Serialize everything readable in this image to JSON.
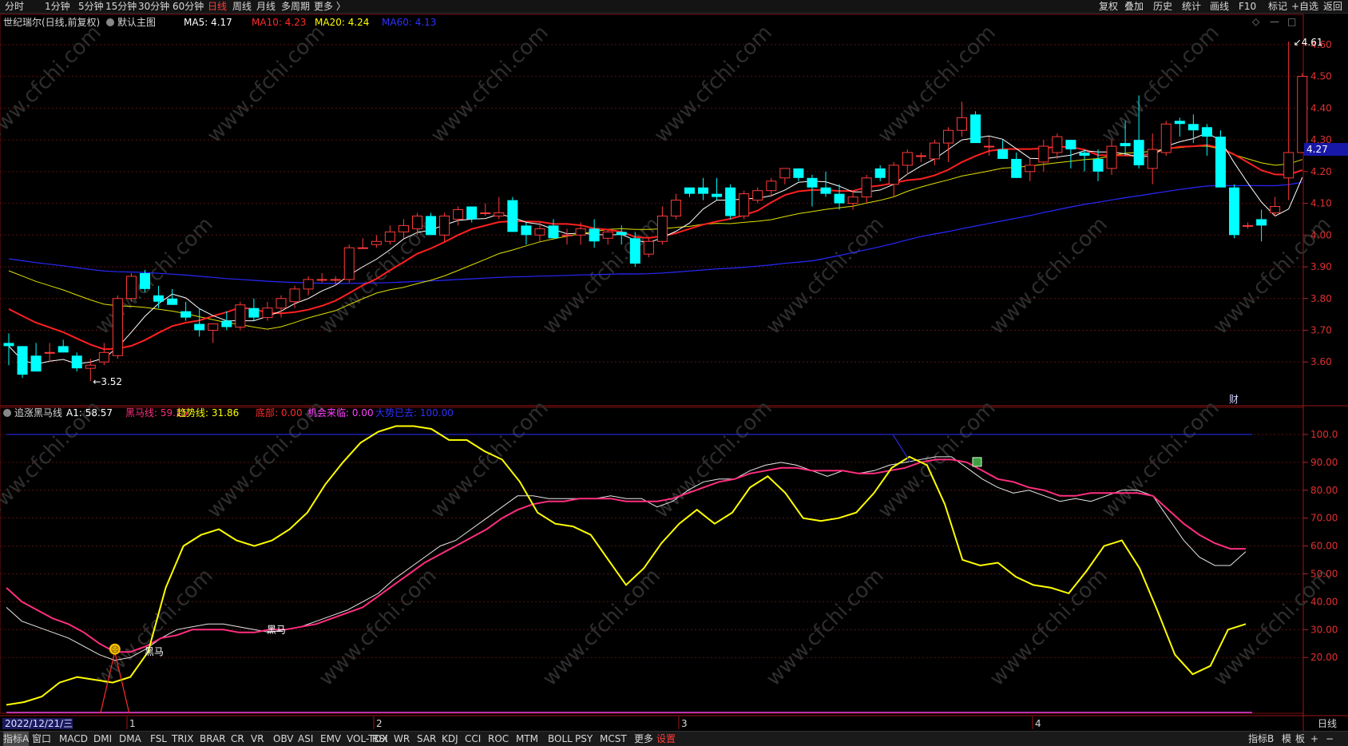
{
  "top_menu": {
    "left": [
      "分时",
      "1分钟",
      "5分钟",
      "15分钟",
      "30分钟",
      "60分钟",
      "日线",
      "周线",
      "月线",
      "多周期",
      "更多 〉"
    ],
    "active": "日线",
    "right": [
      "复权",
      "叠加",
      "历史",
      "统计",
      "画线",
      "F10",
      "标记",
      "+自选",
      "返回"
    ]
  },
  "price_panel": {
    "stock_name": "世纪瑞尔(日线,前复权)",
    "template": "默认主图",
    "ma_labels": [
      {
        "text": "MA5: 4.17",
        "color": "#ffffff"
      },
      {
        "text": "MA10: 4.23",
        "color": "#ff2b2b"
      },
      {
        "text": "MA20: 4.24",
        "color": "#ffff00"
      },
      {
        "text": "MA60: 4.13",
        "color": "#3030ff"
      }
    ],
    "y_ticks": [
      "4.60",
      "4.50",
      "4.40",
      "4.30",
      "4.20",
      "4.10",
      "4.00",
      "3.90",
      "3.80",
      "3.70",
      "3.60"
    ],
    "y_range": [
      3.52,
      4.63
    ],
    "current_price": "4.27",
    "high_mark": "4.61",
    "low_mark": "3.52",
    "fin_marker": "财",
    "window_icons": [
      "◇",
      "—",
      "□"
    ]
  },
  "indicator_panel": {
    "name": "追涨黑马线",
    "labels": [
      {
        "text": "A1: 58.57",
        "color": "#ffffff"
      },
      {
        "text": "黑马线: 59.15",
        "color": "#ff2e7e"
      },
      {
        "text": "趋势线: 31.86",
        "color": "#ffff00"
      },
      {
        "text": "底部: 0.00",
        "color": "#ff2b2b"
      },
      {
        "text": "机会来临: 0.00",
        "color": "#ff40ff"
      },
      {
        "text": "大势已去: 100.00",
        "color": "#3030ff"
      }
    ],
    "y_ticks": [
      "100.0",
      "90.00",
      "80.00",
      "70.00",
      "60.00",
      "50.00",
      "40.00",
      "30.00",
      "20.00"
    ],
    "y_range": [
      0,
      104
    ],
    "dark_horse_tag": "黑马"
  },
  "x_axis": {
    "date_label": "2022/12/21/三",
    "month_marks": [
      "1",
      "2",
      "3",
      "4"
    ],
    "period": "日线"
  },
  "bottom_tabs": {
    "items": [
      "指标A",
      "窗口",
      "MACD",
      "DMI",
      "DMA",
      "FSL",
      "TRIX",
      "BRAR",
      "CR",
      "VR",
      "OBV",
      "ASI",
      "EMV",
      "VOL-TDX",
      "RSI",
      "WR",
      "SAR",
      "KDJ",
      "CCI",
      "ROC",
      "MTM",
      "BOLL",
      "PSY",
      "MCST",
      "更多",
      "设置"
    ],
    "selected": "指标A",
    "active": "设置",
    "right": [
      "指标B",
      "模",
      "板",
      "+",
      "−"
    ]
  },
  "watermark": "www.cfchi.com",
  "chart_data": [
    {
      "type": "candlestick",
      "title": "世纪瑞尔(日线,前复权)",
      "ylim": [
        3.52,
        4.63
      ],
      "candles": [
        [
          3.66,
          3.69,
          3.59,
          3.65
        ],
        [
          3.65,
          3.65,
          3.55,
          3.56
        ],
        [
          3.62,
          3.66,
          3.57,
          3.57
        ],
        [
          3.63,
          3.66,
          3.6,
          3.63
        ],
        [
          3.65,
          3.67,
          3.63,
          3.63
        ],
        [
          3.62,
          3.63,
          3.57,
          3.58
        ],
        [
          3.58,
          3.61,
          3.54,
          3.59
        ],
        [
          3.6,
          3.66,
          3.59,
          3.63
        ],
        [
          3.62,
          3.81,
          3.61,
          3.8
        ],
        [
          3.8,
          3.88,
          3.79,
          3.87
        ],
        [
          3.88,
          3.89,
          3.82,
          3.83
        ],
        [
          3.81,
          3.84,
          3.77,
          3.79
        ],
        [
          3.8,
          3.83,
          3.78,
          3.78
        ],
        [
          3.76,
          3.79,
          3.73,
          3.74
        ],
        [
          3.72,
          3.77,
          3.68,
          3.7
        ],
        [
          3.7,
          3.72,
          3.66,
          3.72
        ],
        [
          3.73,
          3.76,
          3.7,
          3.71
        ],
        [
          3.71,
          3.79,
          3.7,
          3.78
        ],
        [
          3.77,
          3.8,
          3.73,
          3.74
        ],
        [
          3.74,
          3.79,
          3.73,
          3.77
        ],
        [
          3.77,
          3.81,
          3.74,
          3.8
        ],
        [
          3.79,
          3.84,
          3.77,
          3.83
        ],
        [
          3.83,
          3.87,
          3.81,
          3.86
        ],
        [
          3.86,
          3.88,
          3.85,
          3.86
        ],
        [
          3.86,
          3.87,
          3.84,
          3.86
        ],
        [
          3.86,
          3.97,
          3.85,
          3.96
        ],
        [
          3.96,
          3.99,
          3.96,
          3.96
        ],
        [
          3.97,
          4.0,
          3.96,
          3.98
        ],
        [
          3.98,
          4.03,
          3.97,
          4.01
        ],
        [
          4.01,
          4.05,
          3.99,
          4.03
        ],
        [
          4.02,
          4.07,
          4.0,
          4.06
        ],
        [
          4.06,
          4.07,
          4.0,
          4.0
        ],
        [
          4.0,
          4.07,
          3.98,
          4.06
        ],
        [
          4.05,
          4.09,
          4.03,
          4.08
        ],
        [
          4.09,
          4.09,
          4.04,
          4.05
        ],
        [
          4.07,
          4.1,
          4.06,
          4.07
        ],
        [
          4.06,
          4.12,
          4.05,
          4.07
        ],
        [
          4.11,
          4.12,
          4.01,
          4.01
        ],
        [
          4.03,
          4.04,
          3.97,
          4.0
        ],
        [
          4.0,
          4.04,
          3.98,
          4.02
        ],
        [
          4.03,
          4.05,
          3.99,
          3.99
        ],
        [
          4.0,
          4.02,
          3.97,
          4.0
        ],
        [
          4.0,
          4.04,
          3.97,
          4.02
        ],
        [
          4.02,
          4.05,
          3.96,
          3.98
        ],
        [
          3.99,
          4.02,
          3.97,
          4.01
        ],
        [
          4.01,
          4.03,
          3.97,
          4.0
        ],
        [
          3.99,
          4.01,
          3.9,
          3.91
        ],
        [
          3.94,
          3.99,
          3.93,
          3.98
        ],
        [
          3.98,
          4.09,
          3.97,
          4.06
        ],
        [
          4.06,
          4.13,
          4.05,
          4.11
        ],
        [
          4.15,
          4.15,
          4.12,
          4.13
        ],
        [
          4.15,
          4.18,
          4.11,
          4.13
        ],
        [
          4.13,
          4.18,
          4.11,
          4.12
        ],
        [
          4.15,
          4.16,
          4.05,
          4.06
        ],
        [
          4.06,
          4.14,
          4.05,
          4.13
        ],
        [
          4.11,
          4.15,
          4.1,
          4.14
        ],
        [
          4.14,
          4.18,
          4.12,
          4.17
        ],
        [
          4.18,
          4.21,
          4.16,
          4.21
        ],
        [
          4.21,
          4.21,
          4.17,
          4.18
        ],
        [
          4.18,
          4.19,
          4.09,
          4.15
        ],
        [
          4.15,
          4.2,
          4.12,
          4.13
        ],
        [
          4.13,
          4.16,
          4.08,
          4.1
        ],
        [
          4.1,
          4.14,
          4.08,
          4.12
        ],
        [
          4.12,
          4.19,
          4.1,
          4.18
        ],
        [
          4.21,
          4.22,
          4.17,
          4.18
        ],
        [
          4.16,
          4.23,
          4.12,
          4.22
        ],
        [
          4.22,
          4.27,
          4.19,
          4.26
        ],
        [
          4.25,
          4.26,
          4.23,
          4.25
        ],
        [
          4.24,
          4.3,
          4.22,
          4.29
        ],
        [
          4.29,
          4.34,
          4.23,
          4.33
        ],
        [
          4.33,
          4.42,
          4.31,
          4.37
        ],
        [
          4.38,
          4.39,
          4.29,
          4.29
        ],
        [
          4.28,
          4.31,
          4.25,
          4.28
        ],
        [
          4.27,
          4.3,
          4.24,
          4.24
        ],
        [
          4.24,
          4.26,
          4.18,
          4.18
        ],
        [
          4.2,
          4.24,
          4.17,
          4.22
        ],
        [
          4.23,
          4.3,
          4.2,
          4.28
        ],
        [
          4.26,
          4.32,
          4.24,
          4.31
        ],
        [
          4.3,
          4.3,
          4.21,
          4.27
        ],
        [
          4.26,
          4.27,
          4.2,
          4.25
        ],
        [
          4.24,
          4.27,
          4.17,
          4.2
        ],
        [
          4.21,
          4.3,
          4.19,
          4.28
        ],
        [
          4.29,
          4.36,
          4.25,
          4.28
        ],
        [
          4.3,
          4.44,
          4.21,
          4.22
        ],
        [
          4.21,
          4.32,
          4.16,
          4.27
        ],
        [
          4.26,
          4.36,
          4.25,
          4.35
        ],
        [
          4.36,
          4.37,
          4.31,
          4.35
        ],
        [
          4.35,
          4.38,
          4.29,
          4.33
        ],
        [
          4.34,
          4.35,
          4.25,
          4.31
        ],
        [
          4.31,
          4.33,
          4.22,
          4.15
        ],
        [
          4.15,
          4.16,
          3.99,
          4.0
        ],
        [
          4.03,
          4.04,
          4.02,
          4.03
        ],
        [
          4.05,
          4.08,
          3.98,
          4.03
        ],
        [
          4.07,
          4.12,
          4.06,
          4.09
        ],
        [
          4.18,
          4.61,
          4.11,
          4.26
        ],
        [
          4.26,
          4.51,
          4.26,
          4.5
        ]
      ]
    },
    {
      "type": "line",
      "title": "追涨黑马线",
      "ylim": [
        0,
        104
      ],
      "series": [
        {
          "name": "A1",
          "values": [
            38,
            33,
            31,
            29,
            27,
            24,
            21,
            19,
            20,
            23,
            27,
            30,
            31,
            32,
            32,
            31,
            30,
            29,
            30,
            31,
            33,
            35,
            37,
            40,
            43,
            48,
            52,
            56,
            60,
            62,
            66,
            70,
            74,
            78,
            78,
            77,
            77,
            77,
            77,
            78,
            77,
            77,
            74,
            76,
            80,
            83,
            84,
            84,
            87,
            89,
            90,
            89,
            87,
            85,
            87,
            86,
            87,
            89,
            90,
            91,
            92,
            92,
            88,
            84,
            81,
            79,
            80,
            78,
            76,
            77,
            76,
            78,
            80,
            80,
            78,
            70,
            62,
            56,
            53,
            53,
            58
          ]
        },
        {
          "name": "黑马线",
          "values": [
            45,
            40,
            37,
            34,
            32,
            29,
            25,
            22,
            22,
            24,
            27,
            28,
            30,
            30,
            30,
            29,
            29,
            30,
            30,
            31,
            32,
            34,
            36,
            38,
            42,
            46,
            50,
            54,
            57,
            60,
            63,
            66,
            70,
            73,
            75,
            76,
            76,
            77,
            77,
            77,
            76,
            76,
            76,
            77,
            79,
            81,
            83,
            84,
            86,
            87,
            88,
            88,
            87,
            87,
            87,
            86,
            86,
            87,
            88,
            90,
            91,
            91,
            90,
            87,
            84,
            83,
            81,
            80,
            78,
            78,
            79,
            79,
            79,
            79,
            78,
            73,
            68,
            64,
            61,
            59,
            59
          ]
        },
        {
          "name": "趋势线",
          "values": [
            3,
            4,
            6,
            11,
            13,
            12,
            11,
            13,
            22,
            45,
            60,
            64,
            66,
            62,
            60,
            62,
            66,
            72,
            82,
            90,
            97,
            101,
            103,
            103,
            102,
            98,
            98,
            94,
            91,
            83,
            72,
            68,
            67,
            64,
            55,
            46,
            52,
            61,
            68,
            73,
            68,
            72,
            81,
            85,
            79,
            70,
            69,
            70,
            72,
            79,
            88,
            92,
            89,
            75,
            55,
            53,
            54,
            49,
            46,
            45,
            43,
            51,
            60,
            62,
            52,
            37,
            21,
            14,
            17,
            30,
            32
          ]
        },
        {
          "name": "大势已去",
          "values": [
            100,
            100
          ]
        },
        {
          "name": "机会来临",
          "values": [
            0,
            0
          ]
        }
      ]
    }
  ]
}
